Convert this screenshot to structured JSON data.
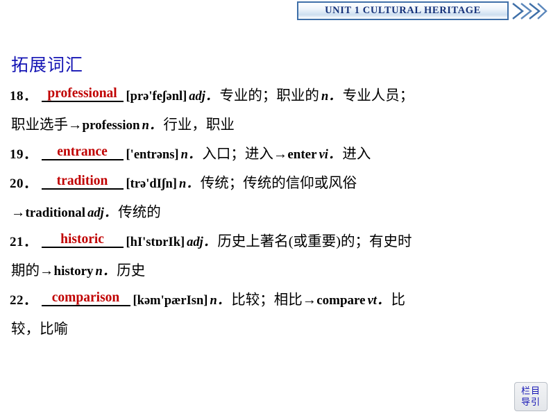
{
  "header": {
    "unit_title": "UNIT 1   CULTURAL HERITAGE",
    "chevron_icon": "double-chevron-right-icon",
    "border_color": "#3e6fa8",
    "title_color": "#16337a"
  },
  "section": {
    "title": "拓展词汇",
    "color": "#1414b4"
  },
  "answer_color": "#c00000",
  "entries": [
    {
      "number": "18．",
      "answer": "professional",
      "phonetic": "[prə'feʃənl]",
      "pos": "adj．",
      "meaning": "专业的；职业的",
      "pos2": "n．",
      "meaning2": "专业人员；",
      "continuation": "职业选手→profession n．行业，职业",
      "continuation_cn_head": "职业选手→",
      "continuation_word": "profession",
      "continuation_pos": "n．",
      "continuation_meaning": "行业，职业"
    },
    {
      "number": "19．",
      "answer": "entrance",
      "phonetic": "['entrəns]",
      "pos": "n．",
      "meaning": "入口；进入→",
      "derived_word": "enter",
      "derived_pos": "vi．",
      "derived_meaning": "进入"
    },
    {
      "number": "20．",
      "answer": "tradition",
      "phonetic": "[trə'dIʃn]",
      "pos": "n．",
      "meaning": "传统；传统的信仰或风俗",
      "continuation_arrow": "→",
      "continuation_word": "traditional",
      "continuation_pos": "adj．",
      "continuation_meaning": "传统的"
    },
    {
      "number": "21．",
      "answer": "historic",
      "phonetic": "[hI'stɒrIk]",
      "pos": "adj．",
      "meaning": "历史上著名(或重要)的；有史时",
      "continuation_cn_head": "期的→",
      "continuation_word": "history",
      "continuation_pos": "n．",
      "continuation_meaning": "历史"
    },
    {
      "number": "22．",
      "answer": "comparison",
      "phonetic": "[kəm'pærIsn]",
      "pos": "n．",
      "meaning": "比较；相比→",
      "derived_word": "compare",
      "derived_pos": "vt．",
      "derived_meaning": "比",
      "continuation": "较，比喻"
    }
  ],
  "corner_badge": {
    "line1": "栏目",
    "line2": "导引",
    "color": "#1414b4"
  }
}
